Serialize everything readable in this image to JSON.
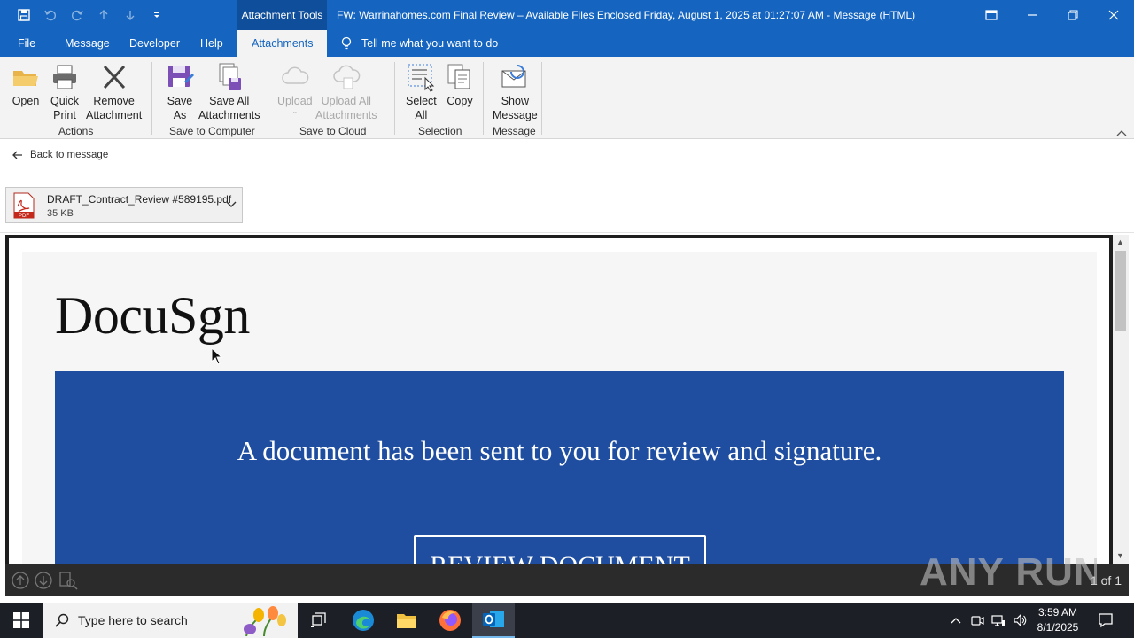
{
  "titlebar": {
    "context_tab": "Attachment Tools",
    "window_title": "FW: Warrinahomes.com Final Review – Available Files Enclosed Friday, August 1, 2025 at 01:27:07 AM  -  Message (HTML)"
  },
  "tabs": {
    "file": "File",
    "message": "Message",
    "developer": "Developer",
    "help": "Help",
    "attachments": "Attachments",
    "tell_me": "Tell me what you want to do"
  },
  "ribbon": {
    "open": "Open",
    "quick_print_1": "Quick",
    "quick_print_2": "Print",
    "remove_1": "Remove",
    "remove_2": "Attachment",
    "save_as_1": "Save",
    "save_as_2": "As",
    "save_all_1": "Save All",
    "save_all_2": "Attachments",
    "upload": "Upload",
    "upload_all_1": "Upload All",
    "upload_all_2": "Attachments",
    "select_all_1": "Select",
    "select_all_2": "All",
    "copy": "Copy",
    "show_message_1": "Show",
    "show_message_2": "Message",
    "groups": {
      "actions": "Actions",
      "save_to_computer": "Save to Computer",
      "save_to_cloud": "Save to Cloud",
      "selection": "Selection",
      "message": "Message"
    }
  },
  "back": {
    "label": "Back to message"
  },
  "attachment": {
    "name": "DRAFT_Contract_Review #589195.pdf",
    "size": "35 KB",
    "icon_label": "PDF"
  },
  "preview": {
    "brand": "DocuSgn",
    "message": "A document has been sent to you for review and signature.",
    "button": "REVIEW DOCUMENT",
    "page_indicator": "1 of 1",
    "watermark": "ANY RUN"
  },
  "taskbar": {
    "search_placeholder": "Type here to search",
    "time": "3:59 AM",
    "date": "8/1/2025"
  },
  "colors": {
    "titlebar": "#1565c0",
    "banner": "#1f4ea0",
    "ribbon_bg": "#f3f3f3",
    "taskbar": "#1c1f26"
  }
}
